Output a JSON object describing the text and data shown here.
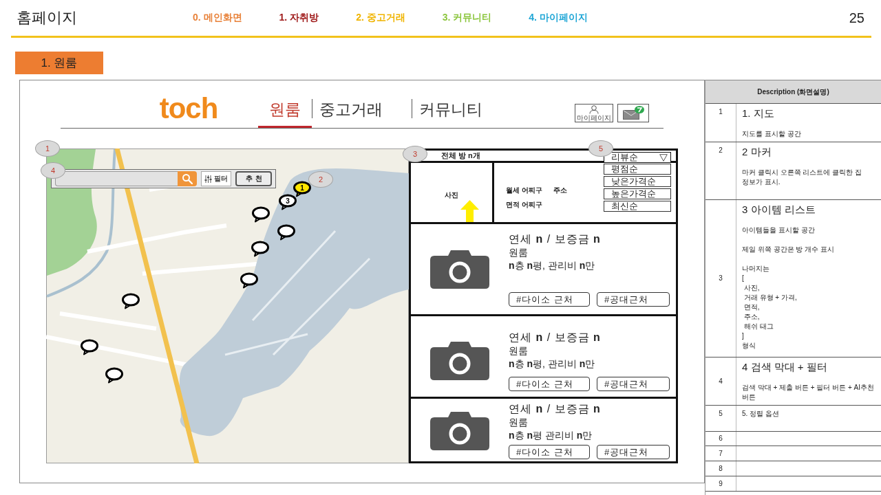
{
  "header": {
    "title": "홈페이지",
    "nav": [
      {
        "label": "0. 메인화면",
        "color": "#e8823a"
      },
      {
        "label": "1. 자취방",
        "color": "#a01c1c"
      },
      {
        "label": "2. 중고거래",
        "color": "#f0b400"
      },
      {
        "label": "3. 커뮤니티",
        "color": "#8cc63e"
      },
      {
        "label": "4. 마이페이지",
        "color": "#1fa6d6"
      }
    ],
    "page_number": "25"
  },
  "section_label": "1. 원룸",
  "wireframe": {
    "logo": "toch",
    "tabs": [
      {
        "label": "원룸",
        "selected": true
      },
      {
        "label": "중고거래",
        "selected": false
      },
      {
        "label": "커뮤니티",
        "selected": false
      }
    ],
    "mypage_label": "마이페이지",
    "callouts": [
      "1",
      "2",
      "3",
      "4",
      "5"
    ],
    "search": {
      "filter_label": "필터",
      "recommend_label": "추천"
    },
    "markers": [
      {
        "label": "1",
        "selected": true
      },
      {
        "label": "3",
        "selected": false
      },
      {
        "selected": false
      },
      {
        "selected": false
      },
      {
        "selected": false
      },
      {
        "selected": false
      },
      {
        "selected": false
      },
      {
        "selected": false
      },
      {
        "selected": false
      }
    ],
    "list": {
      "count_label": "전체 방 n개",
      "sort": {
        "value": "리뷰순",
        "expanded": true,
        "options": [
          "평점순",
          "낮은가격순",
          "높은가격순",
          "최신순"
        ]
      },
      "detail": {
        "photo_label": "사진",
        "rent": "월세 어찌구",
        "address": "주소",
        "area": "면적 어찌구"
      },
      "items": [
        {
          "price": "연세 **n** / 보증금 **n**",
          "type": "원룸",
          "info": "**n**층 **n**평, 관리비 **n**만",
          "tags": [
            "#다이소 근처",
            "#공대근처"
          ]
        },
        {
          "price": "연세 **n** / 보증금 **n**",
          "type": "원룸",
          "info": "**n**층 **n**평, 관리비 **n**만",
          "tags": [
            "#다이소 근처",
            "#공대근처"
          ]
        },
        {
          "price": "연세 **n** / 보증금 **n**",
          "type": "원룸",
          "info": "**n**층 **n**평 관리비 **n**만",
          "tags": [
            "#다이소 근처",
            "#공대근처"
          ]
        }
      ]
    }
  },
  "description": {
    "header": "Description (화면설명)",
    "rows": [
      {
        "number": "1",
        "title": "1. 지도",
        "body": [
          "지도를 표시할 공간"
        ]
      },
      {
        "number": "2",
        "title": "2 마커",
        "body": [
          "마커 클릭시 오른쪽 리스트에 클릭한 집 정보가 표시."
        ]
      },
      {
        "number": "3",
        "title": "3 아이템 리스트",
        "body": [
          "아이템들을 표시할 공간",
          "제일 위쪽 공간은 방 개수 표시",
          "나머지는\n[\n 사진,\n 거래 유형 + 가격,\n 면적,\n 주소,\n 해쉬 태그\n]\n형식"
        ]
      },
      {
        "number": "4",
        "title": "4 검색 막대 + 필터",
        "body": [
          "검색 막대 + 제출 버튼 + 필터 버튼 + AI추천 버튼"
        ]
      },
      {
        "number": "5",
        "body": [
          "5. 정렬 옵션"
        ]
      },
      {
        "number": "6"
      },
      {
        "number": "7"
      },
      {
        "number": "8"
      },
      {
        "number": "9"
      }
    ]
  }
}
